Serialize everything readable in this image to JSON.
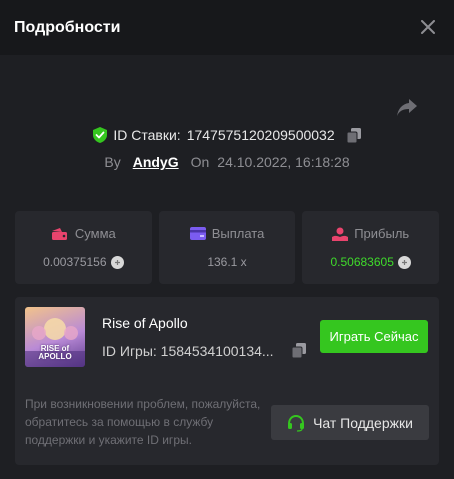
{
  "header": {
    "title": "Подробности"
  },
  "bet": {
    "id_label": "ID Ставки:",
    "id_value": "1747575120209500032",
    "by_label": "By",
    "user": "AndyG",
    "on_label": "On",
    "datetime": "24.10.2022, 16:18:28"
  },
  "stats": {
    "amount": {
      "label": "Сумма",
      "value": "0.00375156"
    },
    "payout": {
      "label": "Выплата",
      "value": "136.1 x"
    },
    "profit": {
      "label": "Прибыль",
      "value": "0.50683605"
    }
  },
  "game": {
    "thumb_text_line1": "RISE of",
    "thumb_text_line2": "APOLLO",
    "name": "Rise of Apollo",
    "id_text": "ID Игры: 1584534100134...",
    "play_label": "Играть Сейчас"
  },
  "support": {
    "text": "При возникновении проблем, пожалуйста, обратитесь за помощью в службу поддержки и укажите ID игры.",
    "button_label": "Чат Поддержки"
  },
  "colors": {
    "accent_green": "#35c61f",
    "profit_green": "#3fdb2b",
    "amount_icon": "#e8446d",
    "payout_icon": "#7b5cf0",
    "profit_icon": "#e8446d"
  },
  "icons": {
    "close": "close-icon",
    "share": "share-icon",
    "shield": "shield-check-icon",
    "copy": "copy-icon",
    "coin": "coin-icon",
    "wallet": "wallet-icon",
    "card": "card-icon",
    "profit": "profit-icon",
    "headset": "headset-icon"
  }
}
